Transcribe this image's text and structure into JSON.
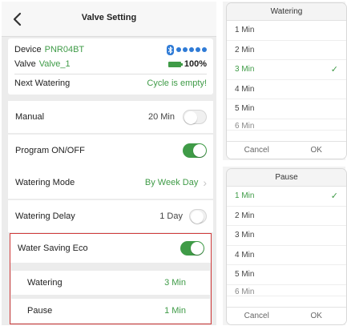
{
  "nav": {
    "title": "Valve Setting"
  },
  "info": {
    "device_label": "Device",
    "device_name": "PNR04BT",
    "valve_label": "Valve",
    "valve_name": "Valve_1",
    "battery": "100%",
    "next_label": "Next Watering",
    "next_value": "Cycle is empty!"
  },
  "rows": {
    "manual_label": "Manual",
    "manual_value": "20 Min",
    "manual_on": false,
    "program_label": "Program ON/OFF",
    "program_on": true,
    "mode_label": "Watering Mode",
    "mode_value": "By Week Day",
    "delay_label": "Watering Delay",
    "delay_value": "1 Day",
    "delay_on": false,
    "eco_label": "Water Saving Eco",
    "eco_on": true,
    "eco_watering_label": "Watering",
    "eco_watering_value": "3 Min",
    "eco_pause_label": "Pause",
    "eco_pause_value": "1 Min"
  },
  "picker_watering": {
    "title": "Watering",
    "options": [
      "1 Min",
      "2 Min",
      "3 Min",
      "4 Min",
      "5 Min",
      "6 Min"
    ],
    "selected": "3 Min",
    "cancel": "Cancel",
    "ok": "OK"
  },
  "picker_pause": {
    "title": "Pause",
    "options": [
      "1 Min",
      "2 Min",
      "3 Min",
      "4 Min",
      "5 Min",
      "6 Min"
    ],
    "selected": "1 Min",
    "cancel": "Cancel",
    "ok": "OK"
  },
  "colors": {
    "accent_green": "#3f9b47",
    "highlight_red": "#d03a3a",
    "bluetooth_blue": "#2f7bd6"
  }
}
